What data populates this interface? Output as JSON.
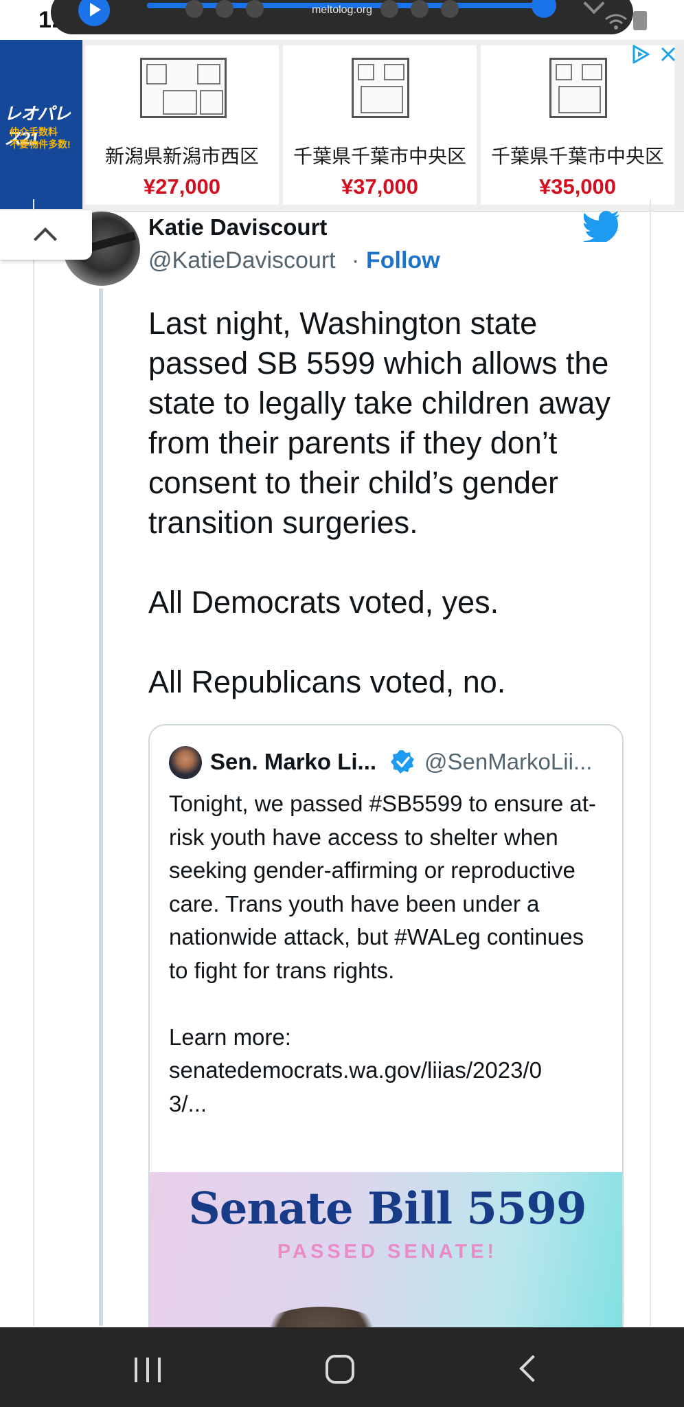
{
  "status_bar": {
    "clock": "12:35",
    "media_url": "meltolog.org"
  },
  "ad": {
    "brand_name": "レオパレス21",
    "brand_line1": "仲介手数料",
    "brand_line2": "不要物件多数!",
    "listings": [
      {
        "location": "新潟県新潟市西区",
        "price": "¥27,000"
      },
      {
        "location": "千葉県千葉市中央区",
        "price": "¥37,000"
      },
      {
        "location": "千葉県千葉市中央区",
        "price": "¥35,000"
      }
    ]
  },
  "tweet": {
    "author_name": "Katie Daviscourt",
    "author_handle": "@KatieDaviscourt",
    "separator": "·",
    "follow_label": "Follow",
    "paragraphs": [
      "Last night, Washington state passed SB 5599 which allows the state to legally take children away from their parents if they don’t consent to their child’s gender transition surgeries.",
      "All Democrats voted, yes.",
      "All Republicans voted, no."
    ]
  },
  "quote": {
    "name": "Sen. Marko Li...",
    "handle": "@SenMarkoLii...",
    "text": "Tonight, we passed #SB5599 to ensure at-risk youth have access to shelter when seeking gender-affirming or reproductive care. Trans youth have been under a nationwide attack, but #WALeg continues to fight for trans rights.\n\nLearn more:\nsenatedemocrats.wa.gov/liias/2023/0\n3/...",
    "image_title": "Senate Bill 5599",
    "image_subtitle": "PASSED SENATE!"
  },
  "colors": {
    "accent": "#1d74c9",
    "twitter_blue": "#1d9bf0",
    "price_red": "#d10f1f",
    "ad_brand_blue": "#16489a"
  }
}
